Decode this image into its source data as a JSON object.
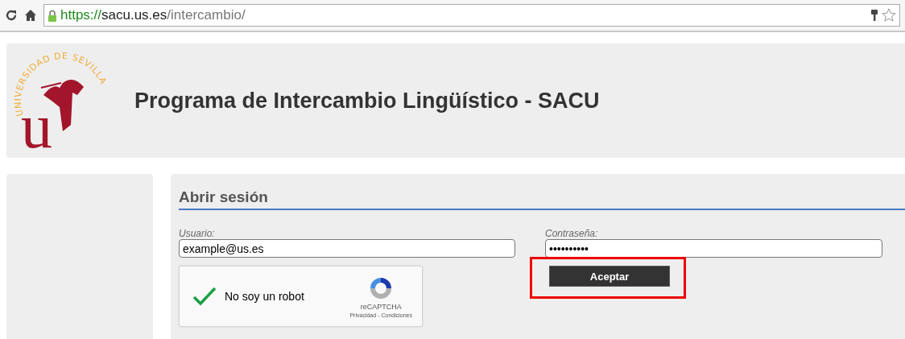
{
  "browser": {
    "url_scheme": "https://",
    "url_host": "sacu.us.es",
    "url_path": "/intercambio/"
  },
  "header": {
    "logo_ring": "UNIVERSIDAD DE SEVILLA",
    "logo_letter": "u",
    "title": "Programa de Intercambio Lingüístico - SACU"
  },
  "login": {
    "heading": "Abrir sesión",
    "fields": [
      {
        "label": "Usuario:",
        "value": "example@us.es"
      },
      {
        "label": "Contraseña:",
        "value": "••••••••••"
      }
    ],
    "captcha": {
      "checked": true,
      "label": "No soy un robot",
      "brand": "reCAPTCHA",
      "privacy": "Privacidad",
      "separator": "-",
      "terms": "Condiciones"
    },
    "submit": {
      "label": "Aceptar",
      "highlighted": true
    }
  }
}
